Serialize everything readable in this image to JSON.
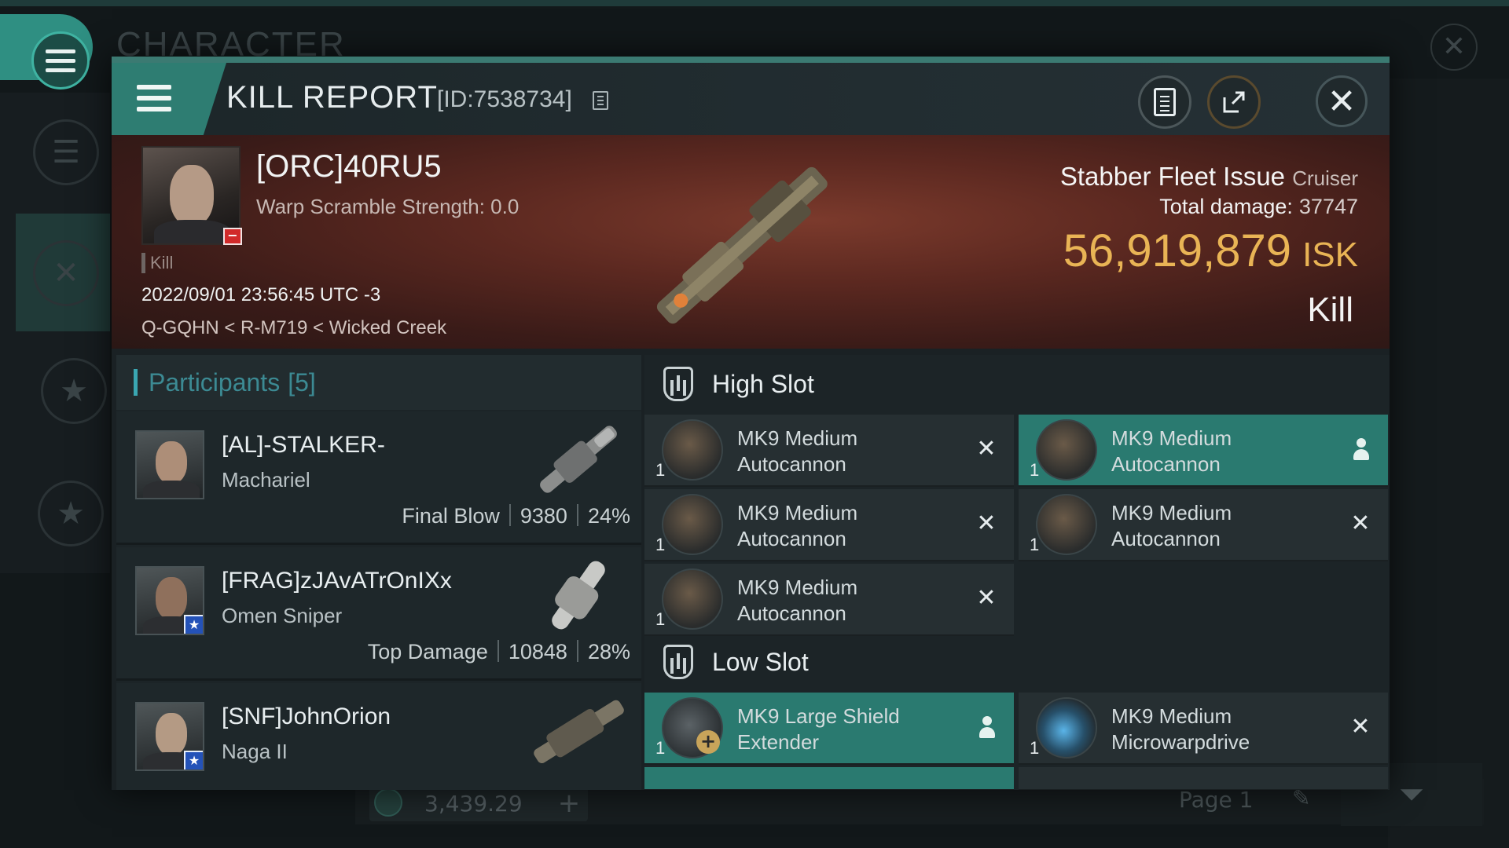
{
  "background": {
    "section_title": "CHARACTER",
    "isk_value": "3,439.29",
    "page_label": "Page 1"
  },
  "header": {
    "title": "KILL REPORT",
    "report_id": "[ID:7538734]"
  },
  "victim": {
    "name": "[ORC]40RU5",
    "warp_scramble": "Warp Scramble Strength: 0.0",
    "tag": "Kill",
    "timestamp": "2022/09/01 23:56:45 UTC -3",
    "location": "Q-GQHN < R-M719 < Wicked Creek",
    "ship_name": "Stabber Fleet Issue",
    "ship_class": "Cruiser",
    "total_damage_label": "Total damage:",
    "total_damage": "37747",
    "isk_value": "56,919,879",
    "isk_currency": "ISK",
    "outcome": "Kill"
  },
  "participants": {
    "label": "Participants",
    "count": "[5]",
    "rows": [
      {
        "name": "[AL]-STALKER-",
        "ship": "Machariel",
        "role": "Final Blow",
        "damage": "9380",
        "percent": "24%"
      },
      {
        "name": "[FRAG]zJAvATrOnIXx",
        "ship": "Omen Sniper",
        "role": "Top Damage",
        "damage": "10848",
        "percent": "28%"
      },
      {
        "name": "[SNF]JohnOrion",
        "ship": "Naga II",
        "role": "",
        "damage": "",
        "percent": ""
      }
    ]
  },
  "fittings": {
    "high_slot_label": "High Slot",
    "low_slot_label": "Low Slot",
    "high": [
      {
        "name": "MK9 Medium Autocannon",
        "qty": "1",
        "state": "destroyed"
      },
      {
        "name": "MK9 Medium Autocannon",
        "qty": "1",
        "state": "dropped"
      },
      {
        "name": "MK9 Medium Autocannon",
        "qty": "1",
        "state": "destroyed"
      },
      {
        "name": "MK9 Medium Autocannon",
        "qty": "1",
        "state": "destroyed"
      },
      {
        "name": "MK9 Medium Autocannon",
        "qty": "1",
        "state": "destroyed"
      }
    ],
    "low": [
      {
        "name": "MK9 Large Shield Extender",
        "qty": "1",
        "state": "dropped"
      },
      {
        "name": "MK9 Medium Microwarpdrive",
        "qty": "1",
        "state": "destroyed"
      }
    ],
    "destroyed_glyph": "✕"
  },
  "colors": {
    "accent": "#2e7d72",
    "isk": "#e9b455",
    "participants_header": "#3c8a93",
    "dropped_highlight": "#2a7a70"
  }
}
